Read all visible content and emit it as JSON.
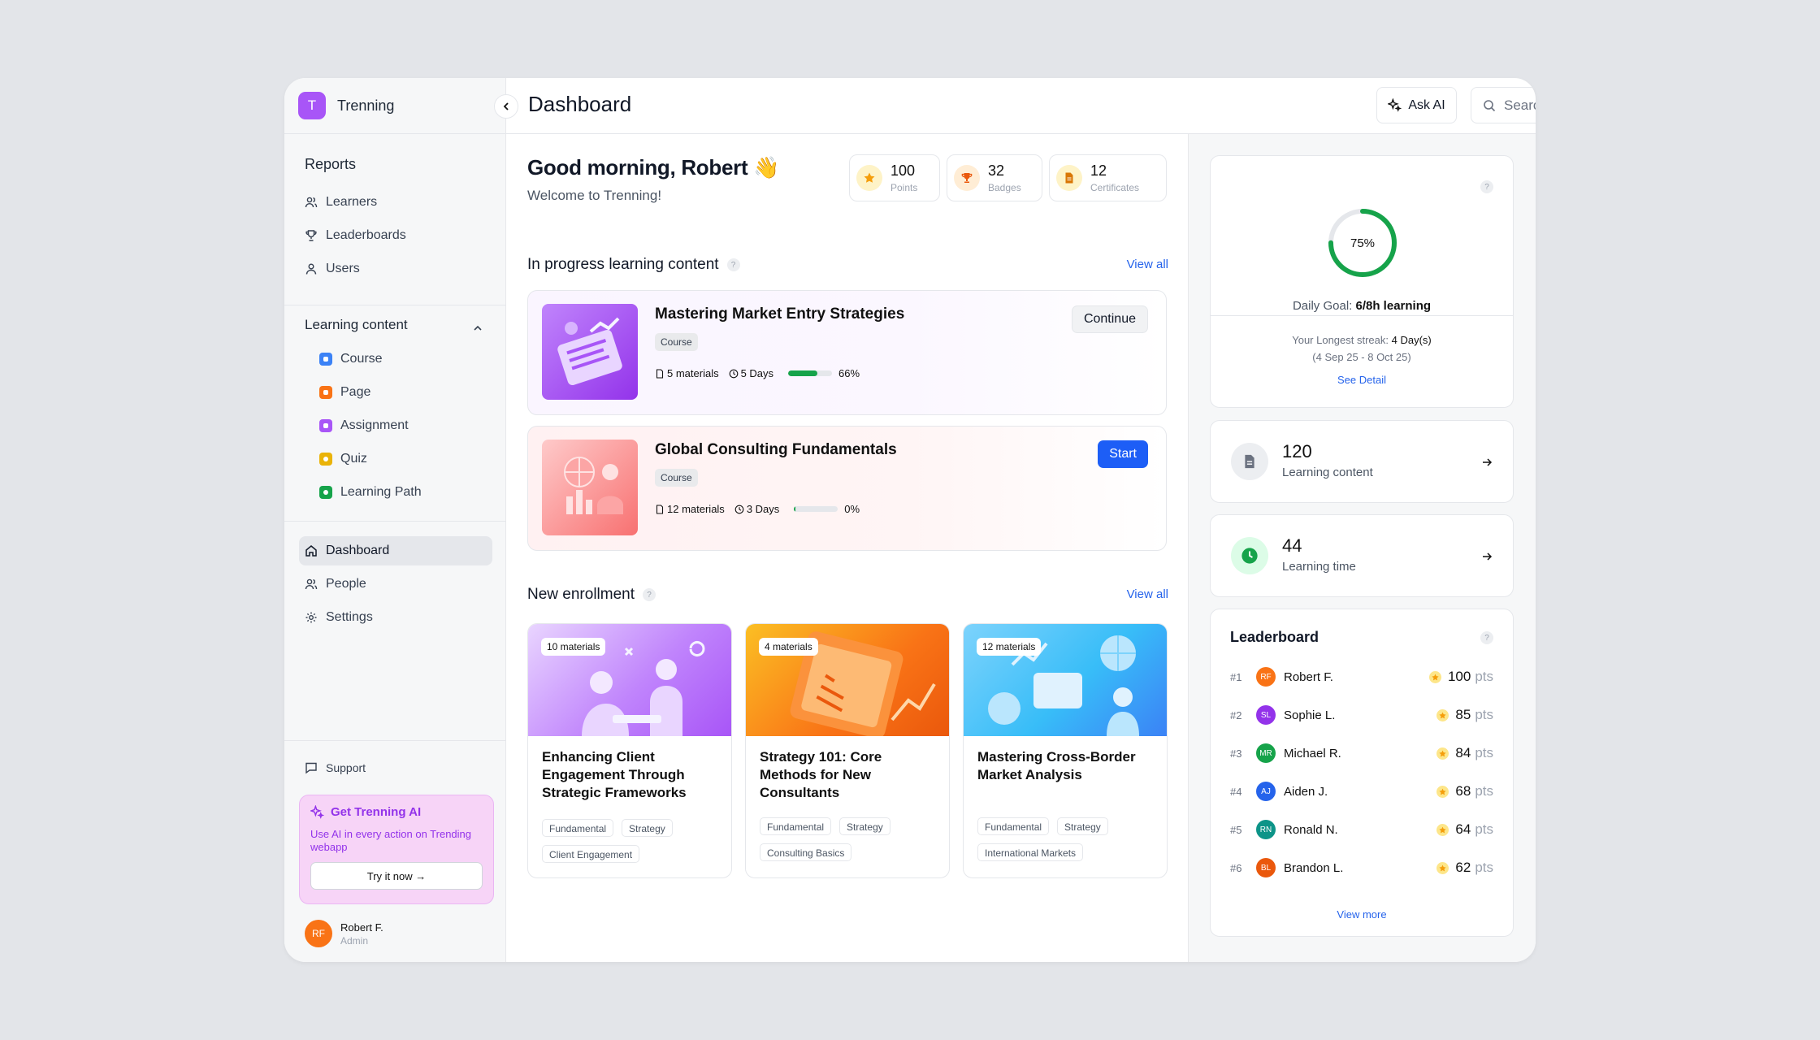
{
  "app": {
    "logo_letter": "T",
    "name": "Trenning"
  },
  "sidebar": {
    "reports_title": "Reports",
    "reports": [
      {
        "label": "Learners"
      },
      {
        "label": "Leaderboards"
      },
      {
        "label": "Users"
      }
    ],
    "learning_title": "Learning content",
    "learning": [
      {
        "label": "Course",
        "color": "#3b82f6"
      },
      {
        "label": "Page",
        "color": "#f97316"
      },
      {
        "label": "Assignment",
        "color": "#a855f7"
      },
      {
        "label": "Quiz",
        "color": "#eab308"
      },
      {
        "label": "Learning Path",
        "color": "#16a34a"
      }
    ],
    "main_nav": [
      {
        "label": "Dashboard",
        "active": true
      },
      {
        "label": "People"
      },
      {
        "label": "Settings"
      }
    ],
    "support": "Support",
    "promo": {
      "title": "Get Trenning AI",
      "desc": "Use AI in every action on Trending webapp",
      "button": "Try it now →"
    },
    "user": {
      "initials": "RF",
      "name": "Robert F.",
      "role": "Admin"
    }
  },
  "header": {
    "title": "Dashboard",
    "ask_ai": "Ask AI",
    "search_placeholder": "Search..."
  },
  "greeting": {
    "title": "Good morning, Robert 👋",
    "subtitle": "Welcome to Trenning!"
  },
  "stats": [
    {
      "value": "100",
      "label": "Points",
      "icon": "star-icon"
    },
    {
      "value": "32",
      "label": "Badges",
      "icon": "trophy-icon"
    },
    {
      "value": "12",
      "label": "Certificates",
      "icon": "certificate-icon"
    }
  ],
  "in_progress": {
    "title": "In progress learning content",
    "view_all": "View all",
    "items": [
      {
        "title": "Mastering Market Entry Strategies",
        "type": "Course",
        "materials": "5 materials",
        "duration": "5 Days",
        "progress_label": "66%",
        "progress": 0.66,
        "action": "Continue"
      },
      {
        "title": "Global Consulting Fundamentals",
        "type": "Course",
        "materials": "12 materials",
        "duration": "3 Days",
        "progress_label": "0%",
        "progress": 0.0,
        "action": "Start"
      }
    ]
  },
  "enrollment": {
    "title": "New enrollment",
    "view_all": "View all",
    "items": [
      {
        "materials": "10 materials",
        "title": "Enhancing Client Engagement Through Strategic Frameworks",
        "tags": [
          "Fundamental",
          "Strategy",
          "Client Engagement"
        ]
      },
      {
        "materials": "4 materials",
        "title": "Strategy 101: Core Methods for New Consultants",
        "tags": [
          "Fundamental",
          "Strategy",
          "Consulting Basics"
        ]
      },
      {
        "materials": "12 materials",
        "title": "Mastering Cross-Border Market Analysis",
        "tags": [
          "Fundamental",
          "Strategy",
          "International Markets"
        ]
      }
    ]
  },
  "daily_goal": {
    "percent_label": "75%",
    "percent": 0.75,
    "label": "Daily Goal: ",
    "value": "6/8h learning",
    "streak_label": "Your Longest streak: ",
    "streak_value": "4 Day(s)",
    "streak_range": "(4 Sep 25 - 8 Oct 25)",
    "see_detail": "See Detail"
  },
  "summary": [
    {
      "value": "120",
      "label": "Learning content"
    },
    {
      "value": "44",
      "label": "Learning time"
    }
  ],
  "leaderboard": {
    "title": "Leaderboard",
    "view_more": "View more",
    "unit": "pts",
    "rows": [
      {
        "rank": "#1",
        "initials": "RF",
        "name": "Robert F.",
        "points": "100",
        "color": "#f97316"
      },
      {
        "rank": "#2",
        "initials": "SL",
        "name": "Sophie L.",
        "points": "85",
        "color": "#9333ea"
      },
      {
        "rank": "#3",
        "initials": "MR",
        "name": "Michael R.",
        "points": "84",
        "color": "#16a34a"
      },
      {
        "rank": "#4",
        "initials": "AJ",
        "name": "Aiden J.",
        "points": "68",
        "color": "#2563eb"
      },
      {
        "rank": "#5",
        "initials": "RN",
        "name": "Ronald N.",
        "points": "64",
        "color": "#0d9488"
      },
      {
        "rank": "#6",
        "initials": "BL",
        "name": "Brandon L.",
        "points": "62",
        "color": "#ea580c"
      }
    ]
  }
}
